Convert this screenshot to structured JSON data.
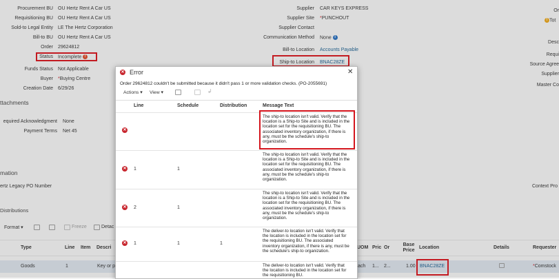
{
  "header": {
    "left_fields": [
      {
        "label": "Procurement BU",
        "value": "OU Hertz Rent A Car US"
      },
      {
        "label": "Requisitioning BU",
        "value": "OU Hertz Rent A Car US"
      },
      {
        "label": "Sold-to Legal Entity",
        "value": "LE The Hertz Corporation"
      },
      {
        "label": "Bill-to BU",
        "value": "OU Hertz Rent A Car US"
      },
      {
        "label": "Order",
        "value": "29624812"
      },
      {
        "label": "Status",
        "value": "Incomplete"
      },
      {
        "label": "Funds Status",
        "value": "Not Applicable"
      },
      {
        "label": "Buyer",
        "value": "Buying Centre"
      },
      {
        "label": "Creation Date",
        "value": "6/29/26"
      }
    ],
    "middle_fields": [
      {
        "label": "Supplier",
        "value": "CAR KEYS EXPRESS"
      },
      {
        "label": "Supplier Site",
        "value": "PUNCHOUT"
      },
      {
        "label": "Supplier Contact",
        "value": ""
      },
      {
        "label": "Communication Method",
        "value": "None"
      },
      {
        "label": "Bill-to Location",
        "value": "Accounts Payable"
      },
      {
        "label": "Ship-to Location",
        "value": "BNAC28ZE"
      }
    ],
    "right_fields": [
      "Or",
      "Tot",
      "Desc",
      "Requi",
      "Source Agree",
      "Supplier",
      "Master Co"
    ]
  },
  "attachments": {
    "title": "ttachments",
    "required_ack_label": "equired Acknowledgment",
    "required_ack_value": "None",
    "payment_terms_label": "Payment Terms",
    "payment_terms_value": "Net 45"
  },
  "information": {
    "title": "mation",
    "legacy_po_label": "ertz Legacy PO Number",
    "context_label": "Context Pro"
  },
  "distributions": {
    "title": "Distributions"
  },
  "lines_toolbar": {
    "format_label": "Format",
    "freeze_label": "Freeze",
    "detach_label": "Detac"
  },
  "lines_table": {
    "headers": {
      "type": "Type",
      "line": "Line",
      "item": "Item",
      "description": "Descri",
      "uom": "UOM",
      "price": "Pric",
      "ordered": "Or",
      "base_price": "Base Price",
      "location": "Location",
      "details": "Details",
      "requester": "Requester"
    },
    "row": {
      "type": "Goods",
      "line": "1",
      "description": "Key or p",
      "uom": "ach",
      "price": "1...",
      "ordered": "2...",
      "base_price": "1.00",
      "location": "BNAC28ZE",
      "requester": "Comstock"
    }
  },
  "dialog": {
    "title": "Error",
    "message": "Order 29624812 couldn't be submitted because it didn't pass 1 or more validation checks. (PO-2055691)",
    "actions_label": "Actions",
    "view_label": "View",
    "columns": {
      "line": "Line",
      "schedule": "Schedule",
      "distribution": "Distribution",
      "message": "Message Text"
    },
    "rows": [
      {
        "line": "",
        "schedule": "",
        "distribution": "",
        "message": "The ship-to location isn't valid. Verify that the location is a Ship-to Site and is included in the location set for the requisitioning BU. The associated inventory organization, if there is any, must be the schedule's ship-to organization."
      },
      {
        "line": "1",
        "schedule": "1",
        "distribution": "",
        "message": "The ship-to location isn't valid. Verify that the location is a Ship-to Site and is included in the location set for the requisitioning BU. The associated inventory organization, if there is any, must be the schedule's ship-to organization."
      },
      {
        "line": "2",
        "schedule": "1",
        "distribution": "",
        "message": "The ship-to location isn't valid. Verify that the location is a Ship-to Site and is included in the location set for the requisitioning BU. The associated inventory organization, if there is any, must be the schedule's ship-to organization."
      },
      {
        "line": "1",
        "schedule": "1",
        "distribution": "1",
        "message": "The deliver-to location isn't valid. Verify that the location is included in the location set for the requisitioning BU. The associated inventory organization, if there is any, must be the schedule's ship-to organization."
      },
      {
        "line": "",
        "schedule": "",
        "distribution": "",
        "message": "The deliver-to location isn't valid. Verify that the location is included in the location set for the requisitioning BU."
      }
    ]
  },
  "colors": {
    "highlight": "#d4141c",
    "link": "#1a5d8c",
    "error": "#c8262e"
  },
  "icons": {
    "error": "error-icon",
    "info": "info-icon",
    "warning": "warning-icon",
    "close": "close-icon"
  }
}
